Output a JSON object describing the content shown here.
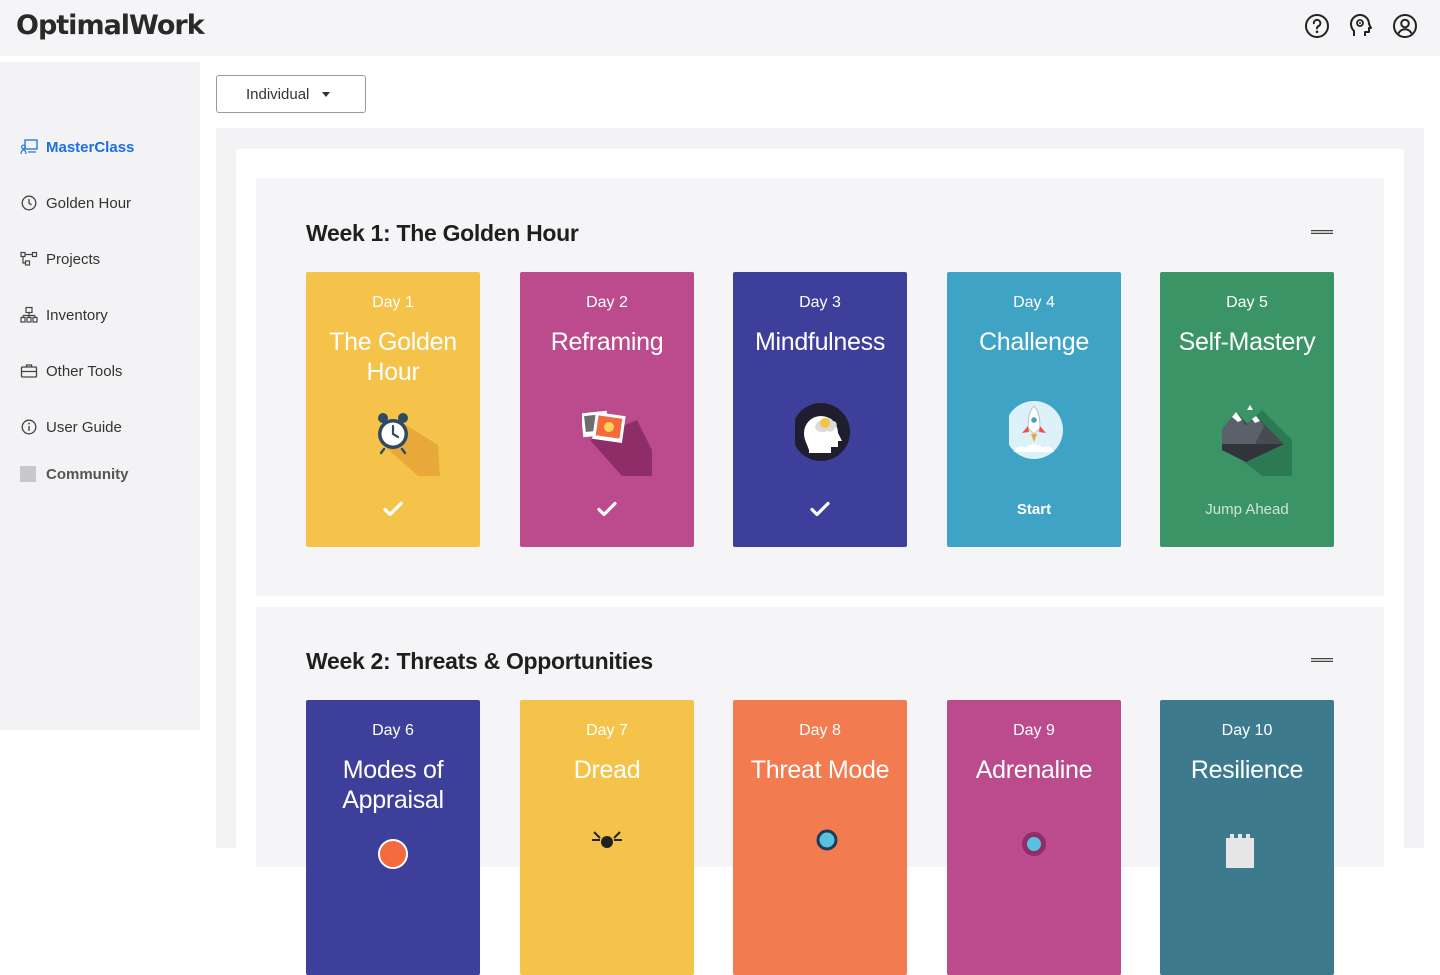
{
  "app": {
    "logo": "OptimalWork"
  },
  "header_icons": [
    "help-icon",
    "brain-settings-icon",
    "account-icon"
  ],
  "sidebar": {
    "items": [
      {
        "label": "MasterClass",
        "icon": "masterclass-icon",
        "active": true
      },
      {
        "label": "Golden Hour",
        "icon": "clock-icon"
      },
      {
        "label": "Projects",
        "icon": "projects-icon"
      },
      {
        "label": "Inventory",
        "icon": "inventory-icon"
      },
      {
        "label": "Other Tools",
        "icon": "toolbox-icon"
      },
      {
        "label": "User Guide",
        "icon": "info-icon"
      },
      {
        "label": "Community",
        "icon": "community-icon"
      }
    ]
  },
  "filter": {
    "selected": "Individual"
  },
  "weeks": [
    {
      "title": "Week 1: The Golden Hour",
      "days": [
        {
          "day": "Day 1",
          "title": "The Golden Hour",
          "status": "completed",
          "status_icon": "checkmark-icon",
          "color": "#F6C34A",
          "illustration": "alarm-clock-icon"
        },
        {
          "day": "Day 2",
          "title": "Reframing",
          "status": "completed",
          "status_icon": "checkmark-icon",
          "color": "#BB4B8D",
          "illustration": "photo-frames-icon"
        },
        {
          "day": "Day 3",
          "title": "Mindfulness",
          "status": "completed",
          "status_icon": "checkmark-icon",
          "color": "#3E3F9A",
          "illustration": "mind-head-icon"
        },
        {
          "day": "Day 4",
          "title": "Challenge",
          "status": "Start",
          "color": "#3EA3C4",
          "illustration": "rocket-icon"
        },
        {
          "day": "Day 5",
          "title": "Self-Mastery",
          "status": "Jump Ahead",
          "color": "#3A9466",
          "illustration": "mountain-icon"
        }
      ]
    },
    {
      "title": "Week 2: Threats & Opportunities",
      "days": [
        {
          "day": "Day 6",
          "title": "Modes of Appraisal",
          "color": "#3E3F9A",
          "illustration": "compass-icon"
        },
        {
          "day": "Day 7",
          "title": "Dread",
          "color": "#F6C34A",
          "illustration": "spider-icon"
        },
        {
          "day": "Day 8",
          "title": "Threat Mode",
          "color": "#F27B50",
          "illustration": "magnifier-icon"
        },
        {
          "day": "Day 9",
          "title": "Adrenaline",
          "color": "#BB4B8D",
          "illustration": "heart-gauge-icon"
        },
        {
          "day": "Day 10",
          "title": "Resilience",
          "color": "#3E7A8E",
          "illustration": "castle-icon"
        }
      ]
    }
  ]
}
